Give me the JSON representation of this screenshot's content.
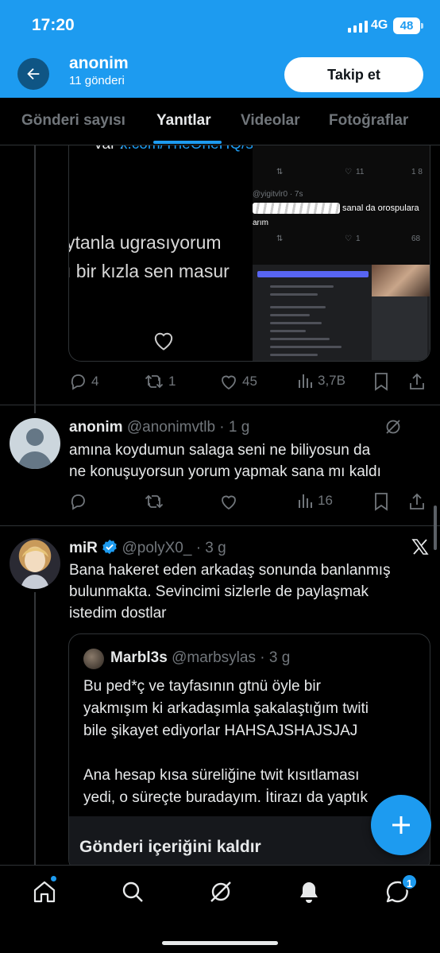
{
  "status_bar": {
    "time": "17:20",
    "network": "4G",
    "battery": "48"
  },
  "header": {
    "name": "anonim",
    "posts_count": "11 gönderi",
    "follow_label": "Takip et"
  },
  "tabs": [
    {
      "label": "Gönderi sayısı"
    },
    {
      "label": "Yanıtlar"
    },
    {
      "label": "Videolar"
    },
    {
      "label": "Fotoğraflar"
    }
  ],
  "quoted_media": {
    "link_prefix": "var :",
    "link_text": "x.com/TheOneHQ/statu...",
    "big_line_1": "ytanla ugrasıyorum",
    "big_line_2": "ı bir kızla sen masur",
    "mini_row_1": {
      "like": "11",
      "views": "1 8"
    },
    "mini_handle": "@yigitvlr0 · 7s",
    "mini_text": "sanal da orospulara",
    "mini_arim": "arım",
    "mini_row_2": {
      "like": "1",
      "views": "68"
    }
  },
  "post1_actions": {
    "replies": "4",
    "reposts": "1",
    "likes": "45",
    "views": "3,7B"
  },
  "tweet2": {
    "name": "anonim",
    "handle": "@anonimvtlb · 1 g",
    "line1": "amına koydumun salaga seni ne biliyosun da",
    "line2": "ne konuşuyorsun yorum yapmak sana mı kaldı",
    "views": "16"
  },
  "tweet3": {
    "name": "miR",
    "handle": "@polyX0_ · 3 g",
    "line1": "Bana hakeret eden arkadaş sonunda banlanmış",
    "line2": "bulunmakta. Sevincimi sizlerle de paylaşmak",
    "line3": "istedim dostlar",
    "quote": {
      "name": "Marbl3s",
      "handle": "@marbsylas · 3 g",
      "line1": "Bu ped*ç ve tayfasının gtnü öyle bir",
      "line2": "yakmışım ki arkadaşımla şakalaştığım twiti",
      "line3": "bile şikayet ediyorlar HAHSAJSHAJSJAJ",
      "line4": "",
      "line5": "Ana hesap kısa süreliğine twit kısıtlaması",
      "line6": "yedi, o süreçte buradayım. İtirazı da yaptık",
      "remove_label": "Gönderi içeriğini kaldır"
    }
  },
  "bottom_nav": {
    "messages_badge": "1"
  },
  "colors": {
    "accent": "#1d9bf0",
    "background": "#000000",
    "muted": "#71767b",
    "verified": "#1d9bf0"
  }
}
